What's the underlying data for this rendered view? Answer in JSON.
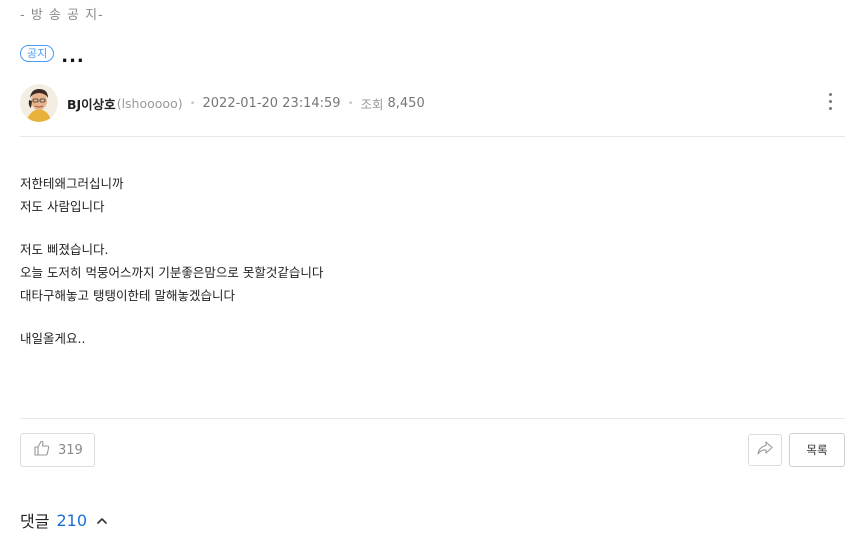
{
  "breadcrumb": "- 방 송 공 지-",
  "post": {
    "badge": "공지",
    "title": "...",
    "author_name": "BJ이상호",
    "author_id": "(lshooooo)",
    "date": "2022-01-20 23:14:59",
    "views_label": "조회",
    "views_count": "8,450",
    "body_lines": [
      "저한테왜그러십니까",
      "저도 사람입니다",
      "",
      "저도 삐졌습니다.",
      "오늘 도저히 먹뭉어스까지 기분좋은맘으로 못할것같습니다",
      "대타구해놓고 탱탱이한테 말해놓겠습니다",
      "",
      "내일올게요.."
    ]
  },
  "actions": {
    "like_count": "319",
    "list_label": "목록"
  },
  "comments": {
    "label": "댓글",
    "count": "210"
  },
  "icons": [
    "thumbs-up-icon",
    "share-icon",
    "more-vertical-icon",
    "chevron-up-icon"
  ],
  "colors": {
    "accent": "#4a9cf5",
    "comment_count": "#1a6fd6"
  }
}
